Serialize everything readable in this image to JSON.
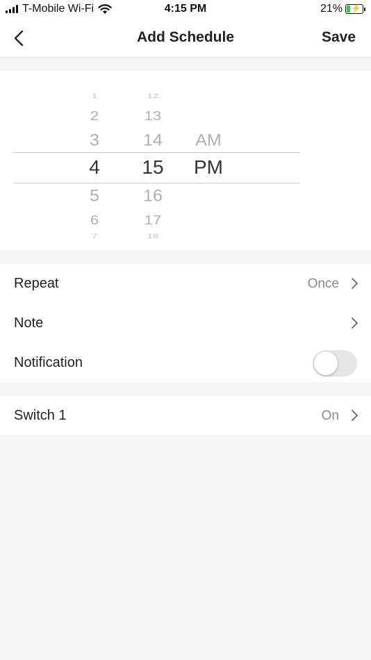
{
  "status_bar": {
    "carrier": "T-Mobile Wi-Fi",
    "time": "4:15 PM",
    "battery": "21%"
  },
  "nav": {
    "title": "Add Schedule",
    "save_label": "Save",
    "back_icon": "chevron-left-icon"
  },
  "picker": {
    "hours": [
      "1",
      "2",
      "3",
      "4",
      "5",
      "6",
      "7"
    ],
    "selected_hour": "4",
    "minutes": [
      "12",
      "13",
      "14",
      "15",
      "16",
      "17",
      "18"
    ],
    "selected_minute": "15",
    "periods": [
      "AM",
      "PM"
    ],
    "selected_period": "PM"
  },
  "settings": {
    "repeat": {
      "label": "Repeat",
      "value": "Once"
    },
    "note": {
      "label": "Note",
      "value": ""
    },
    "notification": {
      "label": "Notification",
      "enabled": false
    }
  },
  "actions": {
    "switch1": {
      "label": "Switch 1",
      "value": "On"
    }
  }
}
